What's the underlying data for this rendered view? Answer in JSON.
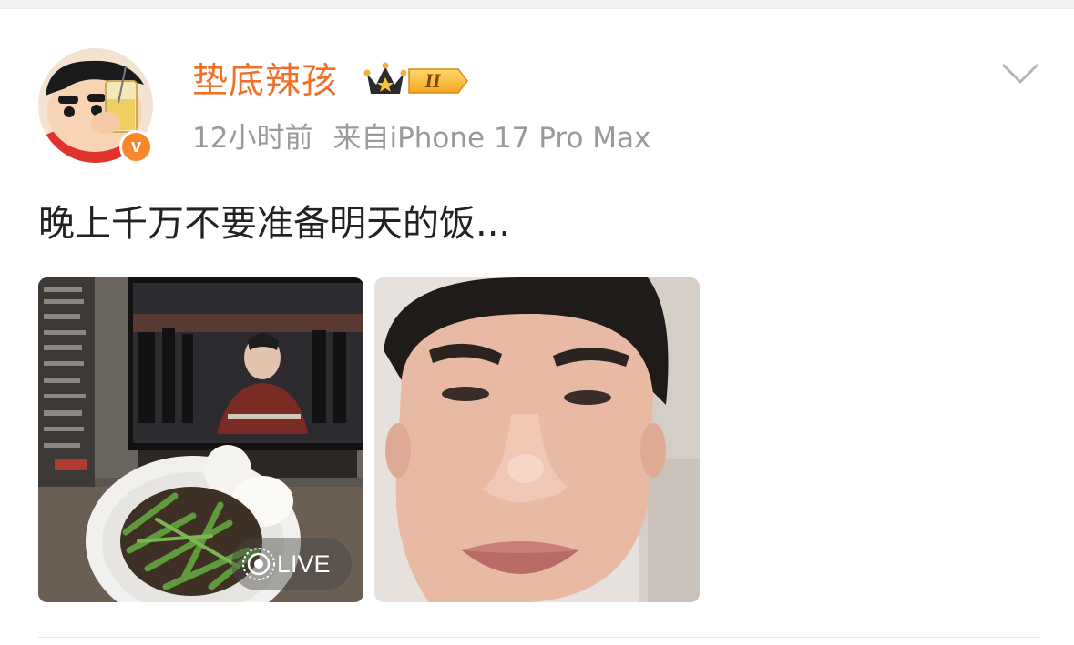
{
  "post": {
    "author": {
      "name": "垫底辣孩",
      "vip_level": "II",
      "verified_mark": "v",
      "avatar_icon": "crayon-shinchan-avatar"
    },
    "meta": {
      "time": "12小时前",
      "source": "来自iPhone 17 Pro Max"
    },
    "text": "晚上千万不要准备明天的饭...",
    "images": [
      {
        "subject": "plate-of-celery-beef-with-buns-in-front-of-tv",
        "live": true
      },
      {
        "subject": "selfie-close-up-face",
        "live": false
      }
    ],
    "live_label": "LIVE",
    "icons": {
      "more": "chevron-down-icon",
      "vip": "crown-icon",
      "live": "live-photo-icon"
    },
    "colors": {
      "username": "#f0702a",
      "verified": "#f6872a",
      "meta": "#9a9a9a",
      "text": "#222222"
    }
  }
}
